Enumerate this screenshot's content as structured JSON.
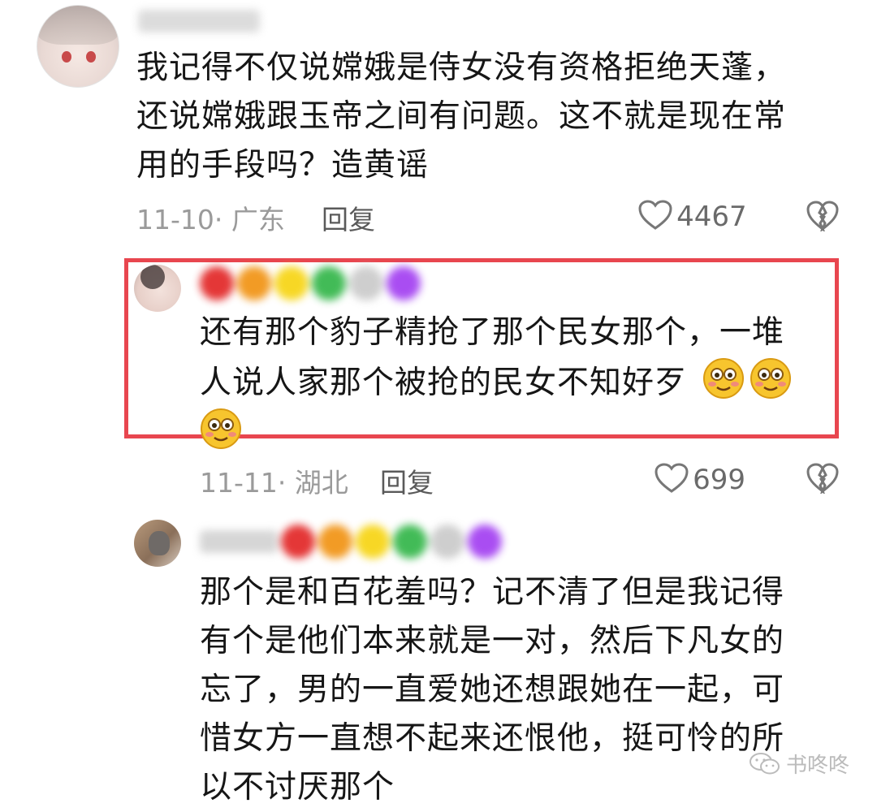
{
  "comments": [
    {
      "text_lines": [
        "我记得不仅说嫦娥是侍女没有资格拒绝天蓬，",
        "还说嫦娥跟玉帝之间有问题。这不就是现在常",
        "用的手段吗？造黄谣"
      ],
      "date": "11-10",
      "location": "广东",
      "reply_label": "回复",
      "likes": "4467"
    },
    {
      "text_lines": [
        "还有那个豹子精抢了那个民女那个，一堆",
        "人说人家那个被抢的民女不知好歹"
      ],
      "date": "11-11",
      "location": "湖北",
      "reply_label": "回复",
      "likes": "699"
    },
    {
      "text_lines": [
        "那个是和百花羞吗？记不清了但是我记得",
        "有个是他们本来就是一对，然后下凡女的",
        "忘了，男的一直爱她还想跟她在一起，可",
        "惜女方一直想不起来还恨他，挺可怜的所",
        "以不讨厌那个"
      ]
    }
  ],
  "name_dot_colors": [
    "#e01515",
    "#f08a00",
    "#f6d100",
    "#22b03a",
    "#c6c6c6",
    "#9b2ff0"
  ],
  "highlight_color": "#e8464f",
  "meta_separator": "·",
  "watermark": "书咚咚",
  "icons": [
    "heart-icon",
    "broken-heart-icon",
    "smiling-blush-emoji",
    "wechat-icon"
  ]
}
